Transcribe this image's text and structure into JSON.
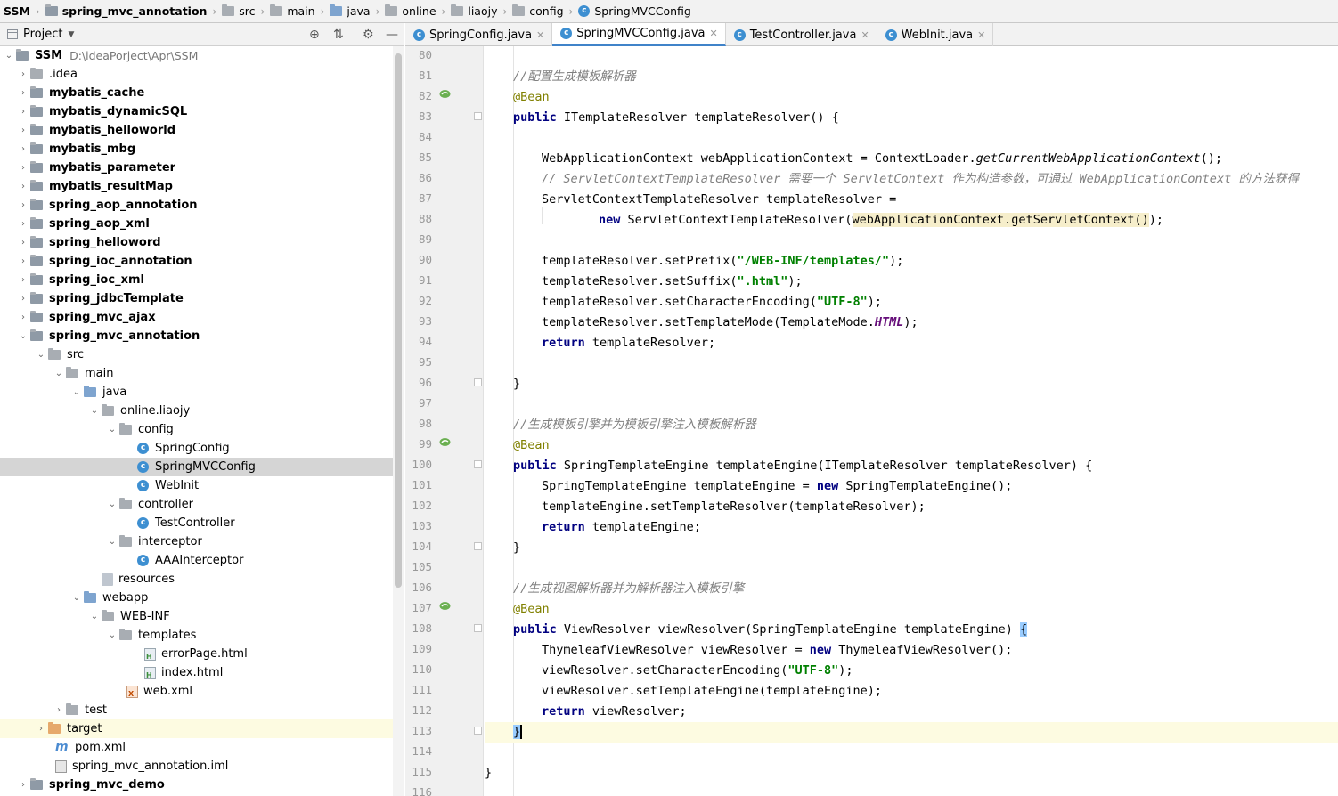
{
  "breadcrumb": [
    "SSM",
    "spring_mvc_annotation",
    "src",
    "main",
    "java",
    "online",
    "liaojy",
    "config",
    "SpringMVCConfig"
  ],
  "project_panel": {
    "title": "Project",
    "root": {
      "name": "SSM",
      "path": "D:\\ideaPorject\\Apr\\SSM"
    },
    "items": [
      ".idea",
      "mybatis_cache",
      "mybatis_dynamicSQL",
      "mybatis_helloworld",
      "mybatis_mbg",
      "mybatis_parameter",
      "mybatis_resultMap",
      "spring_aop_annotation",
      "spring_aop_xml",
      "spring_helloword",
      "spring_ioc_annotation",
      "spring_ioc_xml",
      "spring_jdbcTemplate",
      "spring_mvc_ajax",
      "spring_mvc_annotation",
      "src",
      "main",
      "java",
      "online.liaojy",
      "config",
      "SpringConfig",
      "SpringMVCConfig",
      "WebInit",
      "controller",
      "TestController",
      "interceptor",
      "AAAInterceptor",
      "resources",
      "webapp",
      "WEB-INF",
      "templates",
      "errorPage.html",
      "index.html",
      "web.xml",
      "test",
      "target",
      "pom.xml",
      "spring_mvc_annotation.iml",
      "spring_mvc_demo"
    ]
  },
  "tabs": [
    "SpringConfig.java",
    "SpringMVCConfig.java",
    "TestController.java",
    "WebInit.java"
  ],
  "active_tab": "SpringMVCConfig.java",
  "code": {
    "line_numbers": [
      "80",
      "81",
      "82",
      "83",
      "84",
      "85",
      "86",
      "87",
      "88",
      "89",
      "90",
      "91",
      "92",
      "93",
      "94",
      "95",
      "96",
      "97",
      "98",
      "99",
      "100",
      "101",
      "102",
      "103",
      "104",
      "105",
      "106",
      "107",
      "108",
      "109",
      "110",
      "111",
      "112",
      "113",
      "114",
      "115",
      "116"
    ],
    "l81_comment": "//配置生成模板解析器",
    "bean": "@Bean",
    "kw_public": "public",
    "kw_new": "new",
    "kw_return": "return",
    "l83_rest": "ITemplateResolver templateResolver() {",
    "l85_a": "WebApplicationContext webApplicationContext = ContextLoader.",
    "l85_b": "getCurrentWebApplicationContext",
    "l85_c": "();",
    "l86": "// ServletContextTemplateResolver 需要一个 ServletContext 作为构造参数，可通过 WebApplicationContext 的方法获得",
    "l87": "ServletContextTemplateResolver templateResolver =",
    "l88_a": "ServletContextTemplateResolver(",
    "l88_b": "webApplicationContext.getServletContext()",
    "l88_c": ");",
    "l90_a": "templateResolver.setPrefix(",
    "l90_s": "\"/WEB-INF/templates/\"",
    "l91_a": "templateResolver.setSuffix(",
    "l91_s": "\".html\"",
    "l92_a": "templateResolver.setCharacterEncoding(",
    "l92_s": "\"UTF-8\"",
    "l93_a": "templateResolver.setTemplateMode(TemplateMode.",
    "l93_c": "HTML",
    "close_paren": ");",
    "l94_rest": "templateResolver;",
    "close_brace": "}",
    "l98_comment": "//生成模板引擎并为模板引擎注入模板解析器",
    "l100_rest": "SpringTemplateEngine templateEngine(ITemplateResolver templateResolver) {",
    "l101_a": "SpringTemplateEngine templateEngine = ",
    "l101_b": "SpringTemplateEngine();",
    "l102": "templateEngine.setTemplateResolver(templateResolver);",
    "l103_rest": "templateEngine;",
    "l106_comment": "//生成视图解析器并为解析器注入模板引擎",
    "l108_rest": "ViewResolver viewResolver(SpringTemplateEngine templateEngine) ",
    "l109_a": "ThymeleafViewResolver viewResolver = ",
    "l109_b": "ThymeleafViewResolver();",
    "l110_a": "viewResolver.setCharacterEncoding(",
    "l110_s": "\"UTF-8\"",
    "l111": "viewResolver.setTemplateEngine(templateEngine);",
    "l112_rest": "viewResolver;"
  },
  "colors": {
    "keyword": "#000080",
    "annotation": "#808000",
    "comment": "#808080",
    "string": "#008000",
    "class_icon": "#3d8fd1",
    "current_line": "#fdfbe1",
    "selection": "#d5d5d5",
    "active_tab_underline": "#4083c9"
  }
}
